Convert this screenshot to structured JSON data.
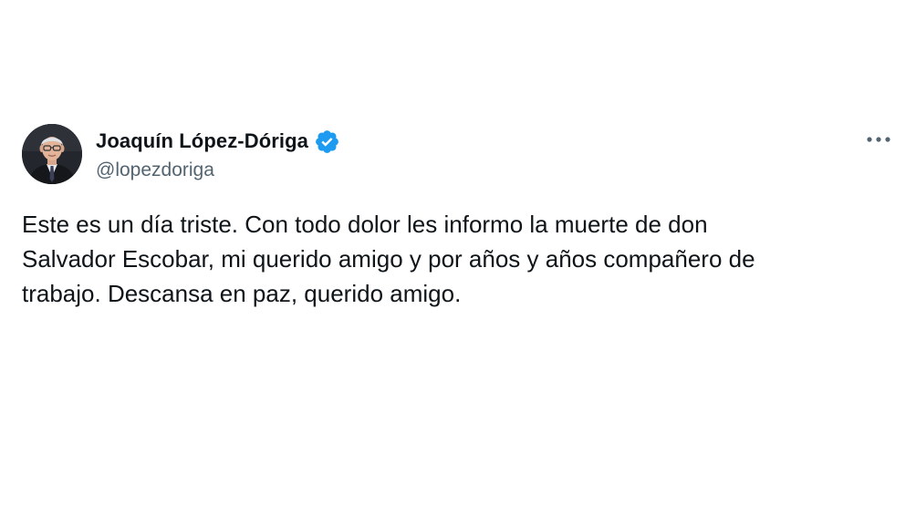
{
  "author": {
    "display_name": "Joaquín López-Dóriga",
    "handle": "@lopezdoriga",
    "verified": true,
    "verified_color": "#1d9bf0",
    "avatar_icon": "profile-photo"
  },
  "actions": {
    "more_icon": "more-horizontal-icon"
  },
  "tweet": {
    "lines": [
      "Este es un día triste. Con todo dolor les informo la muerte de don",
      "Salvador Escobar, mi querido amigo y por años y años compañero de",
      "trabajo. Descansa en paz, querido amigo."
    ]
  }
}
